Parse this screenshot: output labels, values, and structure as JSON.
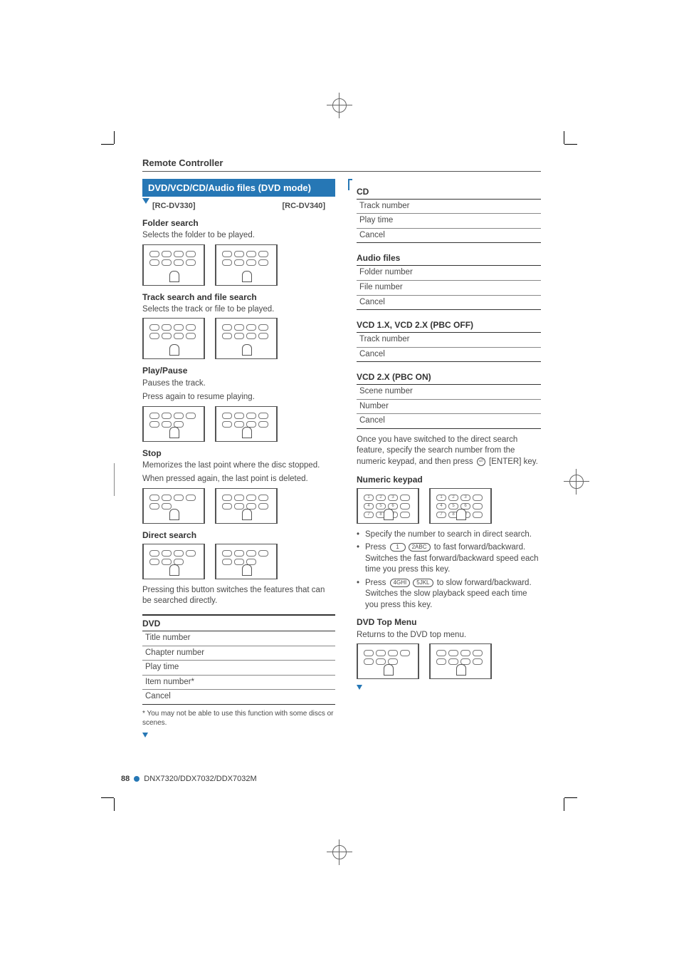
{
  "header": {
    "section_title": "Remote Controller"
  },
  "left": {
    "bluebar": "DVD/VCD/CD/Audio files (DVD mode)",
    "models": {
      "a": "[RC-DV330]",
      "b": "[RC-DV340]"
    },
    "folder_search": {
      "title": "Folder search",
      "desc": "Selects the folder to be played."
    },
    "track_search": {
      "title": "Track search and file search",
      "desc": "Selects the track or file to be played."
    },
    "play_pause": {
      "title": "Play/Pause",
      "l1": "Pauses the track.",
      "l2": "Press again to resume playing."
    },
    "stop": {
      "title": "Stop",
      "l1": "Memorizes the last point where the disc stopped.",
      "l2": "When pressed again, the last point is deleted."
    },
    "direct_search": {
      "title": "Direct search",
      "desc": "Pressing this button switches the features that can be searched directly."
    },
    "dvd": {
      "title": "DVD",
      "rows": [
        "Title number",
        "Chapter number",
        "Play time",
        "Item number*",
        "Cancel"
      ],
      "note": "* You may not be able to use this function with some discs or scenes."
    }
  },
  "right": {
    "cd": {
      "title": "CD",
      "rows": [
        "Track number",
        "Play time",
        "Cancel"
      ]
    },
    "audio": {
      "title": "Audio files",
      "rows": [
        "Folder number",
        "File number",
        "Cancel"
      ]
    },
    "vcd_off": {
      "title": "VCD 1.X, VCD 2.X (PBC OFF)",
      "rows": [
        "Track number",
        "Cancel"
      ]
    },
    "vcd_on": {
      "title": "VCD 2.X (PBC ON)",
      "rows": [
        "Scene number",
        "Number",
        "Cancel"
      ]
    },
    "direct_note": {
      "l1": "Once you have switched to the direct search feature, specify the search number from the numeric keypad, and then press ",
      "l2": " [ENTER] key."
    },
    "numeric": {
      "title": "Numeric keypad",
      "b1": "Specify the number to search in direct search.",
      "b2a": "Press ",
      "b2b": " to fast forward/backward. Switches the fast forward/backward speed each time you press this key.",
      "b3a": "Press ",
      "b3b": " to slow forward/backward. Switches the slow playback speed each time you press this key.",
      "keys": {
        "k1": "1",
        "k2": "2ABC",
        "k4": "4GHI",
        "k5": "5JKL"
      }
    },
    "topmenu": {
      "title": "DVD Top Menu",
      "desc": "Returns to the DVD top menu."
    }
  },
  "footer": {
    "page": "88",
    "models": "DNX7320/DDX7032/DDX7032M"
  }
}
